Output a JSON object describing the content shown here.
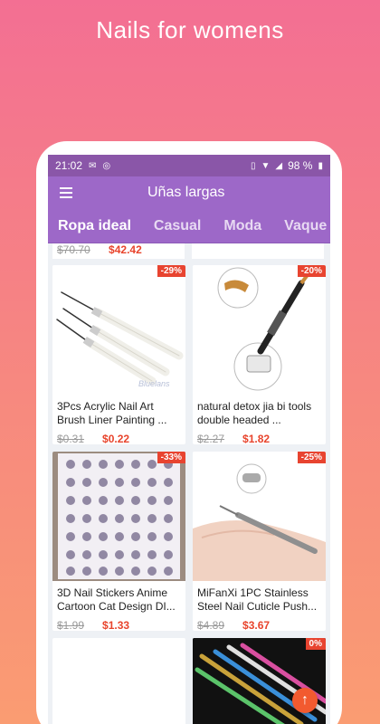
{
  "promo": {
    "title": "Nails for womens"
  },
  "status_bar": {
    "time": "21:02",
    "battery": "98 %"
  },
  "app_bar": {
    "title": "Uñas largas"
  },
  "tabs": [
    {
      "label": "Ropa ideal",
      "active": true
    },
    {
      "label": "Casual",
      "active": false
    },
    {
      "label": "Moda",
      "active": false
    },
    {
      "label": "Vaque",
      "active": false
    }
  ],
  "previous_row": {
    "old_price": "$70.70",
    "new_price": "$42.42"
  },
  "products": [
    {
      "name": "3Pcs Acrylic Nail Art Brush Liner Painting ...",
      "old_price": "$0.31",
      "new_price": "$0.22",
      "discount": "-29%",
      "image": "nail-brushes",
      "watermark": "Bluelans"
    },
    {
      "name": "natural detox jia bi tools double headed ...",
      "old_price": "$2.27",
      "new_price": "$1.82",
      "discount": "-20%",
      "image": "dotting-pen"
    },
    {
      "name": "3D Nail Stickers Anime Cartoon Cat Design DI...",
      "old_price": "$1.99",
      "new_price": "$1.33",
      "discount": "-33%",
      "image": "sticker-sheet"
    },
    {
      "name": "MiFanXi 1PC Stainless Steel Nail Cuticle Push...",
      "old_price": "$4.89",
      "new_price": "$3.67",
      "discount": "-25%",
      "image": "cuticle-pusher"
    },
    {
      "name": "",
      "old_price": "",
      "new_price": "",
      "discount": "",
      "image": "blank"
    },
    {
      "name": "",
      "old_price": "",
      "new_price": "",
      "discount": "0%",
      "image": "dotting-tools"
    }
  ],
  "fab": {
    "icon": "arrow-up-icon",
    "glyph": "↑"
  },
  "colors": {
    "status_bar": "#8A56A8",
    "app_bar": "#9D68C8",
    "price_red": "#E8442C",
    "fab": "#F25A2F"
  }
}
